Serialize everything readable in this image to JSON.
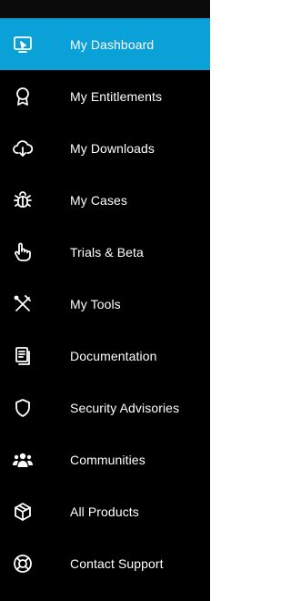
{
  "sidebar": {
    "accent_color": "#0aa1d9",
    "items": [
      {
        "label": "My Dashboard",
        "icon": "monitor-cursor-icon",
        "active": true
      },
      {
        "label": "My Entitlements",
        "icon": "award-ribbon-icon",
        "active": false
      },
      {
        "label": "My Downloads",
        "icon": "cloud-download-icon",
        "active": false
      },
      {
        "label": "My Cases",
        "icon": "bug-icon",
        "active": false
      },
      {
        "label": "Trials & Beta",
        "icon": "pointer-hand-icon",
        "active": false
      },
      {
        "label": "My Tools",
        "icon": "tools-icon",
        "active": false
      },
      {
        "label": "Documentation",
        "icon": "documents-icon",
        "active": false
      },
      {
        "label": "Security Advisories",
        "icon": "shield-icon",
        "active": false
      },
      {
        "label": "Communities",
        "icon": "people-group-icon",
        "active": false
      },
      {
        "label": "All Products",
        "icon": "cube-icon",
        "active": false
      },
      {
        "label": "Contact Support",
        "icon": "lifebuoy-icon",
        "active": false
      }
    ]
  }
}
